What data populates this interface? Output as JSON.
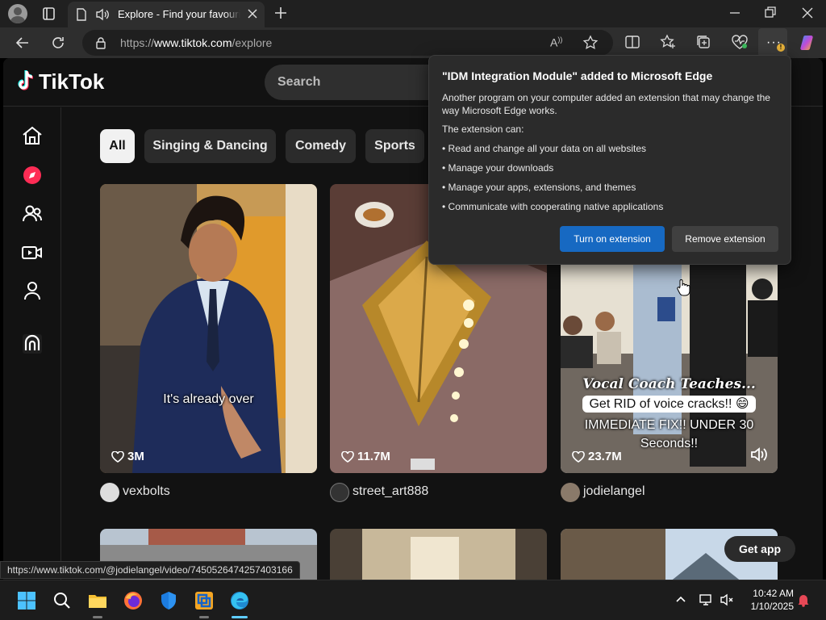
{
  "browser": {
    "tab_title": "Explore - Find your favourite",
    "url_prefix": "https://",
    "url_domain": "www.tiktok.com",
    "url_path": "/explore",
    "read_aloud_label": "A",
    "more_warning": "!"
  },
  "tiktok": {
    "logo_text": "TikTok",
    "search_placeholder": "Search",
    "sidebar": [
      {
        "name": "home-icon"
      },
      {
        "name": "explore-icon"
      },
      {
        "name": "following-icon"
      },
      {
        "name": "live-icon"
      },
      {
        "name": "profile-icon"
      },
      {
        "name": "more-icon"
      }
    ],
    "chips": [
      "All",
      "Singing & Dancing",
      "Comedy",
      "Sports"
    ],
    "videos": [
      {
        "likes": "3M",
        "caption": "It's already over",
        "author": "vexbolts"
      },
      {
        "likes": "11.7M",
        "caption": "",
        "author": "street_art888"
      },
      {
        "likes": "23.7M",
        "caption_line1": "Vocal Coach Teaches...",
        "caption_line2": "Get RID of voice cracks!! 😄",
        "caption_line3": "IMMEDIATE FIX!! UNDER 30",
        "caption_line4": "Seconds!!",
        "author": "jodielangel"
      }
    ],
    "get_app": "Get app"
  },
  "extension_popup": {
    "title": "\"IDM Integration Module\" added to Microsoft Edge",
    "body": "Another program on your computer added an extension that may change the way Microsoft Edge works.",
    "can_label": "The extension can:",
    "perms": [
      "• Read and change all your data on all websites",
      "• Manage your downloads",
      "• Manage your apps, extensions, and themes",
      "• Communicate with cooperating native applications"
    ],
    "primary_btn": "Turn on extension",
    "secondary_btn": "Remove extension"
  },
  "status_bar_url": "https://www.tiktok.com/@jodielangel/video/7450526474257403166",
  "taskbar": {
    "time": "10:42 AM",
    "date": "1/10/2025"
  },
  "colors": {
    "accent_blue": "#1769c2",
    "tiktok_red": "#fe2c55",
    "tiktok_cyan": "#25f4ee"
  }
}
